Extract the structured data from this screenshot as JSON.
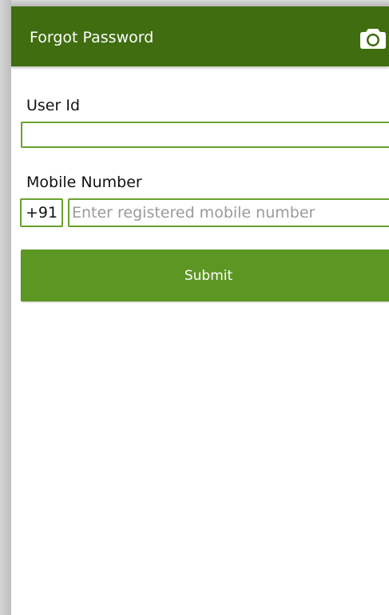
{
  "app_bar": {
    "title": "Forgot Password",
    "action_icon": "camera-icon",
    "background_color": "#3f6d0f"
  },
  "form": {
    "user_id": {
      "label": "User Id",
      "value": "",
      "placeholder": ""
    },
    "mobile": {
      "label": "Mobile Number",
      "country_code": "+91",
      "value": "",
      "placeholder": "Enter registered mobile number"
    },
    "submit_label": "Submit"
  },
  "colors": {
    "accent": "#6aa12e",
    "button": "#5c9623"
  }
}
